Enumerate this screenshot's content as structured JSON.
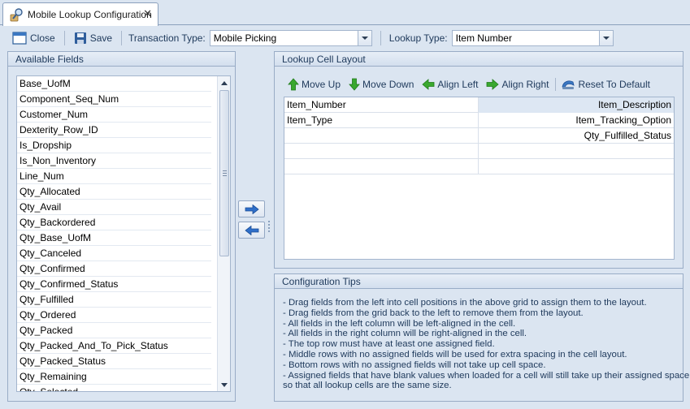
{
  "tab": {
    "title": "Mobile Lookup Configuration",
    "close_glyph": "✕"
  },
  "toolbar": {
    "close_label": "Close",
    "save_label": "Save",
    "transaction_type_label": "Transaction Type:",
    "transaction_type_value": "Mobile Picking",
    "lookup_type_label": "Lookup Type:",
    "lookup_type_value": "Item Number"
  },
  "available_fields": {
    "title": "Available Fields",
    "items": [
      "Base_UofM",
      "Component_Seq_Num",
      "Customer_Num",
      "Dexterity_Row_ID",
      "Is_Dropship",
      "Is_Non_Inventory",
      "Line_Num",
      "Qty_Allocated",
      "Qty_Avail",
      "Qty_Backordered",
      "Qty_Base_UofM",
      "Qty_Canceled",
      "Qty_Confirmed",
      "Qty_Confirmed_Status",
      "Qty_Fulfilled",
      "Qty_Ordered",
      "Qty_Packed",
      "Qty_Packed_And_To_Pick_Status",
      "Qty_Packed_Status",
      "Qty_Remaining",
      "Qty_Selected"
    ]
  },
  "lookup_cell_layout": {
    "title": "Lookup Cell Layout",
    "buttons": {
      "move_up": "Move Up",
      "move_down": "Move Down",
      "align_left": "Align Left",
      "align_right": "Align Right",
      "reset": "Reset To Default"
    },
    "rows": [
      {
        "left": "Item_Number",
        "right": "Item_Description"
      },
      {
        "left": "Item_Type",
        "right": "Item_Tracking_Option"
      },
      {
        "left": "",
        "right": "Qty_Fulfilled_Status"
      },
      {
        "left": "",
        "right": ""
      },
      {
        "left": "",
        "right": ""
      }
    ]
  },
  "configuration_tips": {
    "title": "Configuration Tips",
    "lines": [
      "- Drag fields from the left into cell positions in the above grid to assign them to the layout.",
      "- Drag fields from the grid back to the left to remove them from the layout.",
      "- All fields in the left column will be left-aligned in the cell.",
      "- All fields in the right column will be right-aligned in the cell.",
      "- The top row must have at least one assigned field.",
      "- Middle rows with no assigned fields will be used for extra spacing in the cell layout.",
      "- Bottom rows with no assigned fields will not take up cell space.",
      "- Assigned fields that have blank values when loaded for a cell will still take up their assigned space",
      "so that all lookup cells are the same size."
    ]
  },
  "icons": {
    "tab": "magnifier-icon",
    "close": "close-window-icon",
    "save": "floppy-disk-icon",
    "move_up": "green-arrow-up-icon",
    "move_down": "green-arrow-down-icon",
    "align_left": "green-arrow-left-icon",
    "align_right": "green-arrow-right-icon",
    "reset": "reset-icon",
    "add": "blue-arrow-right-icon",
    "remove": "blue-arrow-left-icon"
  },
  "colors": {
    "background": "#dbe5f1",
    "border": "#99acc6",
    "label_text": "#1e395b",
    "arrow_green": "#3aa82f",
    "arrow_blue": "#2f6fc9"
  }
}
